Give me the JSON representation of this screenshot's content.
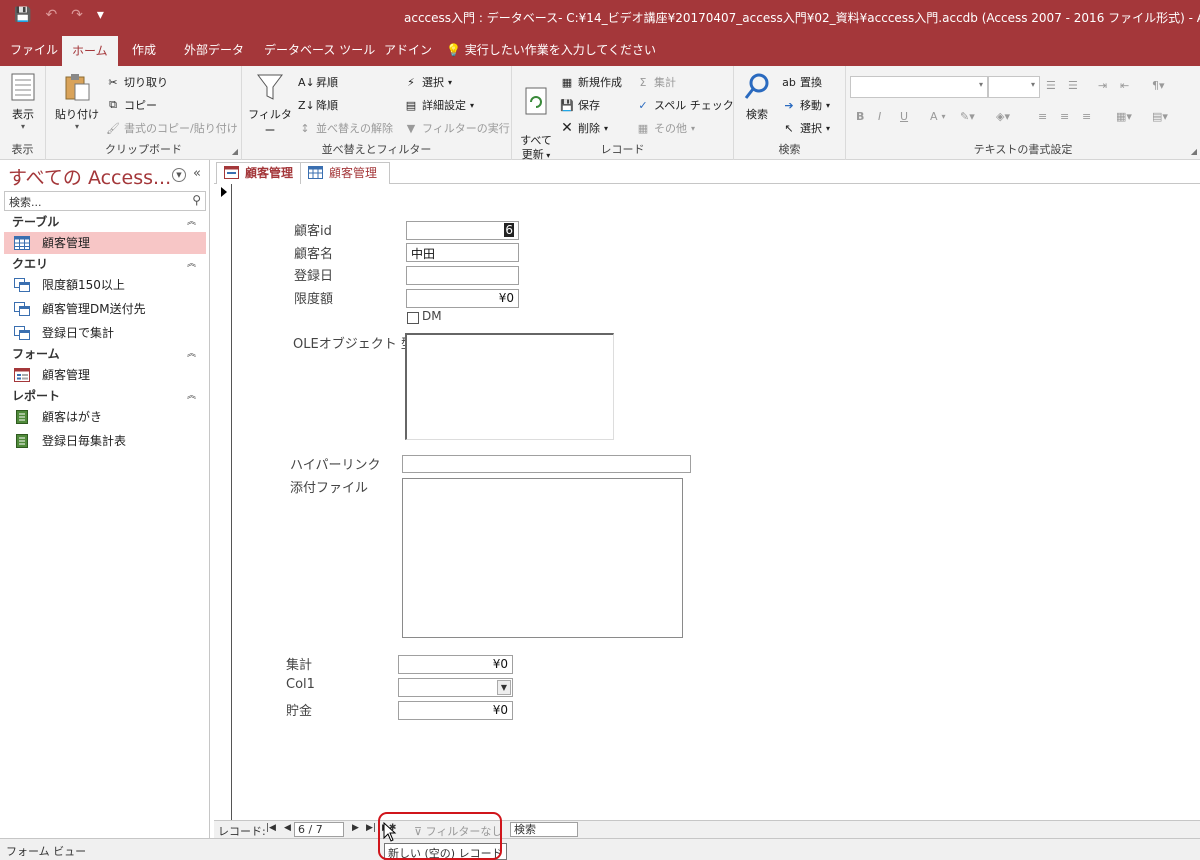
{
  "titlebar": {
    "title": "acccess入門 : データベース- C:¥14_ビデオ講座¥20170407_access入門¥02_資料¥acccess入門.accdb (Access 2007 - 2016 ファイル形式)  -  Access",
    "save_icon": "💾",
    "undo_icon": "↶",
    "redo_icon": "↷",
    "customize_icon": "▾"
  },
  "tabs": [
    "ファイル",
    "ホーム",
    "作成",
    "外部データ",
    "データベース ツール",
    "アドイン"
  ],
  "tellme": "実行したい作業を入力してください",
  "ribbon": {
    "view": {
      "label": "表示",
      "group": "表示"
    },
    "clipboard": {
      "paste": "貼り付け",
      "cut": "切り取り",
      "copy": "コピー",
      "format_painter": "書式のコピー/貼り付け",
      "group": "クリップボード"
    },
    "sort_filter": {
      "filter": "フィルター",
      "asc": "昇順",
      "desc": "降順",
      "remove_sort": "並べ替えの解除",
      "selection": "選択",
      "advanced": "詳細設定",
      "toggle_filter": "フィルターの実行",
      "group": "並べ替えとフィルター"
    },
    "records": {
      "refresh": "すべて\n更新",
      "new": "新規作成",
      "save": "保存",
      "delete": "削除",
      "totals": "集計",
      "spelling": "スペル チェック",
      "more": "その他",
      "group": "レコード"
    },
    "find": {
      "find": "検索",
      "replace": "置換",
      "goto": "移動",
      "select": "選択",
      "group": "検索"
    },
    "text_format": {
      "group": "テキストの書式設定",
      "bold": "B",
      "italic": "I",
      "underline": "U",
      "font_color": "A"
    }
  },
  "nav": {
    "title": "すべての Access...",
    "search_placeholder": "検索...",
    "sections": [
      {
        "label": "テーブル",
        "items": [
          "顧客管理"
        ]
      },
      {
        "label": "クエリ",
        "items": [
          "限度額150以上",
          "顧客管理DM送付先",
          "登録日で集計"
        ]
      },
      {
        "label": "フォーム",
        "items": [
          "顧客管理"
        ]
      },
      {
        "label": "レポート",
        "items": [
          "顧客はがき",
          "登録日毎集計表"
        ]
      }
    ]
  },
  "doc_tabs": [
    "顧客管理",
    "顧客管理"
  ],
  "form": {
    "labels": {
      "id": "顧客id",
      "name": "顧客名",
      "date": "登録日",
      "limit": "限度額",
      "dm": "DM",
      "ole": "OLEオブジェクト 型",
      "hyperlink": "ハイパーリンク",
      "attachment": "添付ファイル",
      "total": "集計",
      "col1": "Col1",
      "savings": "貯金"
    },
    "values": {
      "id": "6",
      "name": "中田",
      "date": "",
      "limit": "¥0",
      "total": "¥0",
      "col1": "",
      "savings": "¥0"
    }
  },
  "record_nav": {
    "label": "レコード:",
    "position": "6 / 7",
    "filter": "フィルターなし",
    "search": "検索"
  },
  "tooltip": "新しい (空の) レコード",
  "status": "フォーム ビュー",
  "colors": {
    "accent": "#a4373a",
    "selected_item": "#f7c6c6",
    "highlight_ring": "#d0151b"
  }
}
